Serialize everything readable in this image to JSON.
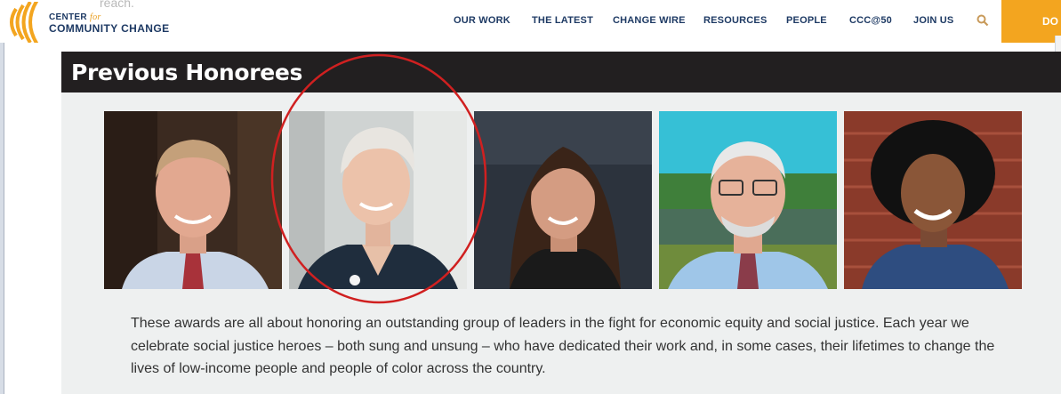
{
  "header": {
    "ghost_text": "reach.",
    "logo": {
      "line1_a": "CENTER",
      "line1_b": "for",
      "line2": "COMMUNITY CHANGE"
    },
    "nav": [
      {
        "label": "OUR WORK"
      },
      {
        "label": "THE LATEST"
      },
      {
        "label": "CHANGE WIRE"
      },
      {
        "label": "RESOURCES"
      },
      {
        "label": "PEOPLE"
      },
      {
        "label": "CCC@50"
      },
      {
        "label": "JOIN US"
      }
    ],
    "search_icon": "search-icon",
    "donate_label": "DO"
  },
  "section": {
    "title": "Previous Honorees",
    "body": "These awards are all about honoring an outstanding group of leaders in the fight for economic equity and social justice. Each year we celebrate social justice heroes – both sung and unsung – who have dedicated their work and, in some cases, their lifetimes to change the lives of low-income people and people of color across the country."
  },
  "colors": {
    "brand_navy": "#1e3a64",
    "brand_orange": "#f3a51f",
    "title_bar": "#221f20",
    "annotation": "#d02020"
  }
}
